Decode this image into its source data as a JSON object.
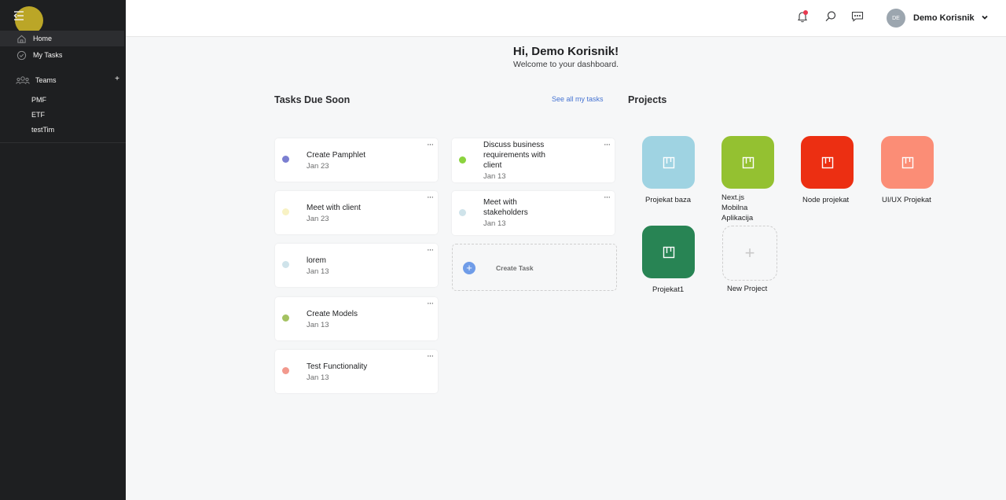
{
  "sidebar": {
    "toggle_icon": "menu-collapse-icon",
    "items": [
      {
        "label": "Home",
        "icon": "home-icon"
      },
      {
        "label": "My Tasks",
        "icon": "check-circle-icon"
      }
    ],
    "teams_label": "Teams",
    "teams_icon": "people-icon",
    "add_team": "+",
    "teams": [
      "PMF",
      "ETF",
      "testTim"
    ]
  },
  "topbar": {
    "icons": [
      "bell-icon",
      "search-icon",
      "chat-icon"
    ],
    "avatar_initials": "DE",
    "user_name": "Demo Korisnik"
  },
  "greeting": {
    "title": "Hi, Demo Korisnik!",
    "subtitle": "Welcome to your dashboard."
  },
  "tasks": {
    "section_title": "Tasks Due Soon",
    "see_all": "See all my tasks",
    "menu_label": "···",
    "create_label": "Create Task",
    "create_icon": "+",
    "left_column": [
      {
        "title": "Create Pamphlet",
        "date": "Jan 23",
        "color": "#7b7fd1"
      },
      {
        "title": "Meet with client",
        "date": "Jan 23",
        "color": "#f8f2c4"
      },
      {
        "title": "lorem",
        "date": "Jan 13",
        "color": "#cfe3ea"
      },
      {
        "title": "Create Models",
        "date": "Jan 13",
        "color": "#a4c261"
      },
      {
        "title": "Test Functionality",
        "date": "Jan 13",
        "color": "#f2998d"
      }
    ],
    "right_column": [
      {
        "title": "Discuss business requirements with client",
        "date": "Jan 13",
        "color": "#8bd33e"
      },
      {
        "title": "Meet with stakeholders",
        "date": "Jan 13",
        "color": "#cfe3ea"
      }
    ]
  },
  "projects": {
    "section_title": "Projects",
    "tile_icon": "board-icon",
    "items": [
      {
        "name": "Projekat baza",
        "color": "#9fd3e2"
      },
      {
        "name": "Next.js Mobilna Aplikacija",
        "color": "#94c131"
      },
      {
        "name": "Node projekat",
        "color": "#ec2f12"
      },
      {
        "name": "UI/UX Projekat",
        "color": "#fb8d76"
      },
      {
        "name": "Projekat1",
        "color": "#288454"
      }
    ],
    "new_label": "New Project",
    "new_icon": "+"
  }
}
